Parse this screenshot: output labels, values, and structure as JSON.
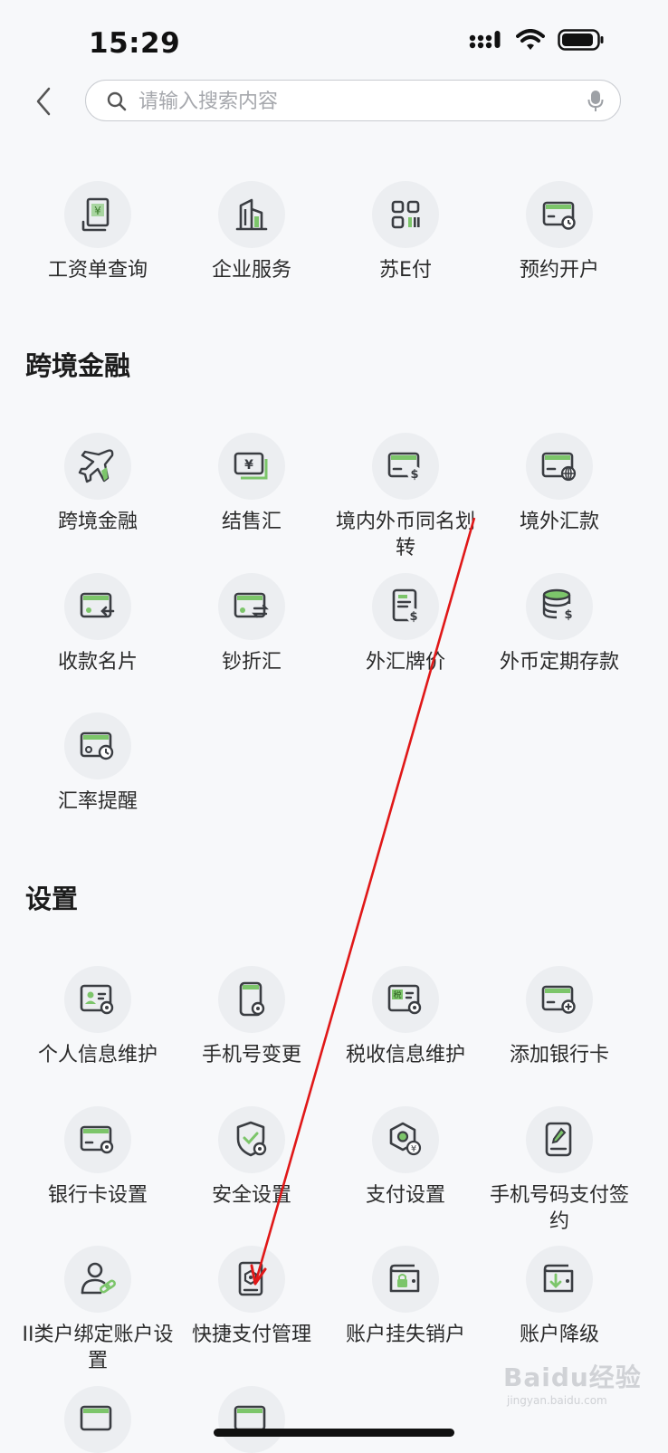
{
  "status": {
    "time": "15:29"
  },
  "search": {
    "placeholder": "请输入搜索内容"
  },
  "quick_items": [
    {
      "label": "工资单查询",
      "icon": "payslip-icon"
    },
    {
      "label": "企业服务",
      "icon": "building-icon"
    },
    {
      "label": "苏E付",
      "icon": "qr-code-icon"
    },
    {
      "label": "预约开户",
      "icon": "appointment-card-icon"
    }
  ],
  "sections": [
    {
      "title": "跨境金融",
      "items": [
        {
          "label": "跨境金融",
          "icon": "airplane-icon"
        },
        {
          "label": "结售汇",
          "icon": "yuan-bills-icon"
        },
        {
          "label": "境内外币同名划转",
          "icon": "card-dollar-icon"
        },
        {
          "label": "境外汇款",
          "icon": "card-globe-icon"
        },
        {
          "label": "收款名片",
          "icon": "card-receive-icon"
        },
        {
          "label": "钞折汇",
          "icon": "card-exchange-icon"
        },
        {
          "label": "外汇牌价",
          "icon": "doc-dollar-icon"
        },
        {
          "label": "外币定期存款",
          "icon": "coin-stack-icon"
        },
        {
          "label": "汇率提醒",
          "icon": "card-clock-icon"
        }
      ]
    },
    {
      "title": "设置",
      "items": [
        {
          "label": "个人信息维护",
          "icon": "id-card-gear-icon"
        },
        {
          "label": "手机号变更",
          "icon": "phone-gear-icon"
        },
        {
          "label": "税收信息维护",
          "icon": "tax-card-gear-icon"
        },
        {
          "label": "添加银行卡",
          "icon": "card-add-icon"
        },
        {
          "label": "银行卡设置",
          "icon": "card-gear-icon"
        },
        {
          "label": "安全设置",
          "icon": "shield-gear-icon"
        },
        {
          "label": "支付设置",
          "icon": "hexagon-pay-icon"
        },
        {
          "label": "手机号码支付签约",
          "icon": "tablet-pen-icon"
        },
        {
          "label": "II类户绑定账户设置",
          "icon": "user-link-icon"
        },
        {
          "label": "快捷支付管理",
          "icon": "phone-safe-icon"
        },
        {
          "label": "账户挂失销户",
          "icon": "wallet-lock-icon"
        },
        {
          "label": "账户降级",
          "icon": "wallet-down-icon"
        }
      ]
    }
  ],
  "watermark": {
    "text": "Baidu经验",
    "sub": "jingyan.baidu.com"
  },
  "colors": {
    "accent": "#4caf3a",
    "annotation": "#e01818"
  }
}
